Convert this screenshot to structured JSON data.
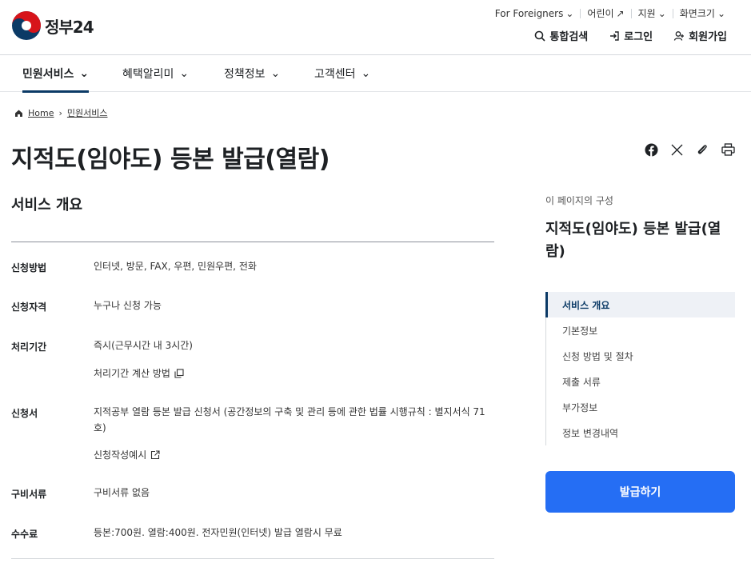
{
  "header": {
    "logo_text": "정부24",
    "util": {
      "foreigners": "For Foreigners",
      "kids": "어린이",
      "support": "지원",
      "zoom": "화면크기"
    },
    "actions": {
      "search": "통합검색",
      "login": "로그인",
      "signup": "회원가입"
    }
  },
  "nav": {
    "items": [
      "민원서비스",
      "혜택알리미",
      "정책정보",
      "고객센터"
    ]
  },
  "breadcrumb": {
    "home": "Home",
    "current": "민원서비스"
  },
  "page": {
    "title": "지적도(임야도) 등본 발급(열람)",
    "section_title": "서비스 개요"
  },
  "overview": {
    "method_label": "신청방법",
    "method_value": "인터넷, 방문, FAX, 우편, 민원우편, 전화",
    "eligibility_label": "신청자격",
    "eligibility_value": "누구나 신청 가능",
    "period_label": "처리기간",
    "period_value": "즉시(근무시간 내 3시간)",
    "period_link": "처리기간 계산 방법",
    "form_label": "신청서",
    "form_value": "지적공부 열람 등본 발급 신청서 (공간정보의 구축 및 관리 등에 관한 법률 시행규칙 : 별지서식 71호)",
    "form_link": "신청작성예시",
    "docs_label": "구비서류",
    "docs_value": "구비서류 없음",
    "fee_label": "수수료",
    "fee_value": "등본:700원. 열람:400원. 전자민원(인터넷) 발급 열람시 무료"
  },
  "toc": {
    "caption": "이 페이지의 구성",
    "title": "지적도(임야도) 등본 발급(열람)",
    "items": [
      "서비스 개요",
      "기본정보",
      "신청 방법 및 절차",
      "제출 서류",
      "부가정보",
      "정보 변경내역"
    ]
  },
  "cta": {
    "label": "발급하기"
  },
  "colors": {
    "primary": "#256ef4",
    "nav_active": "#0b3a66"
  }
}
